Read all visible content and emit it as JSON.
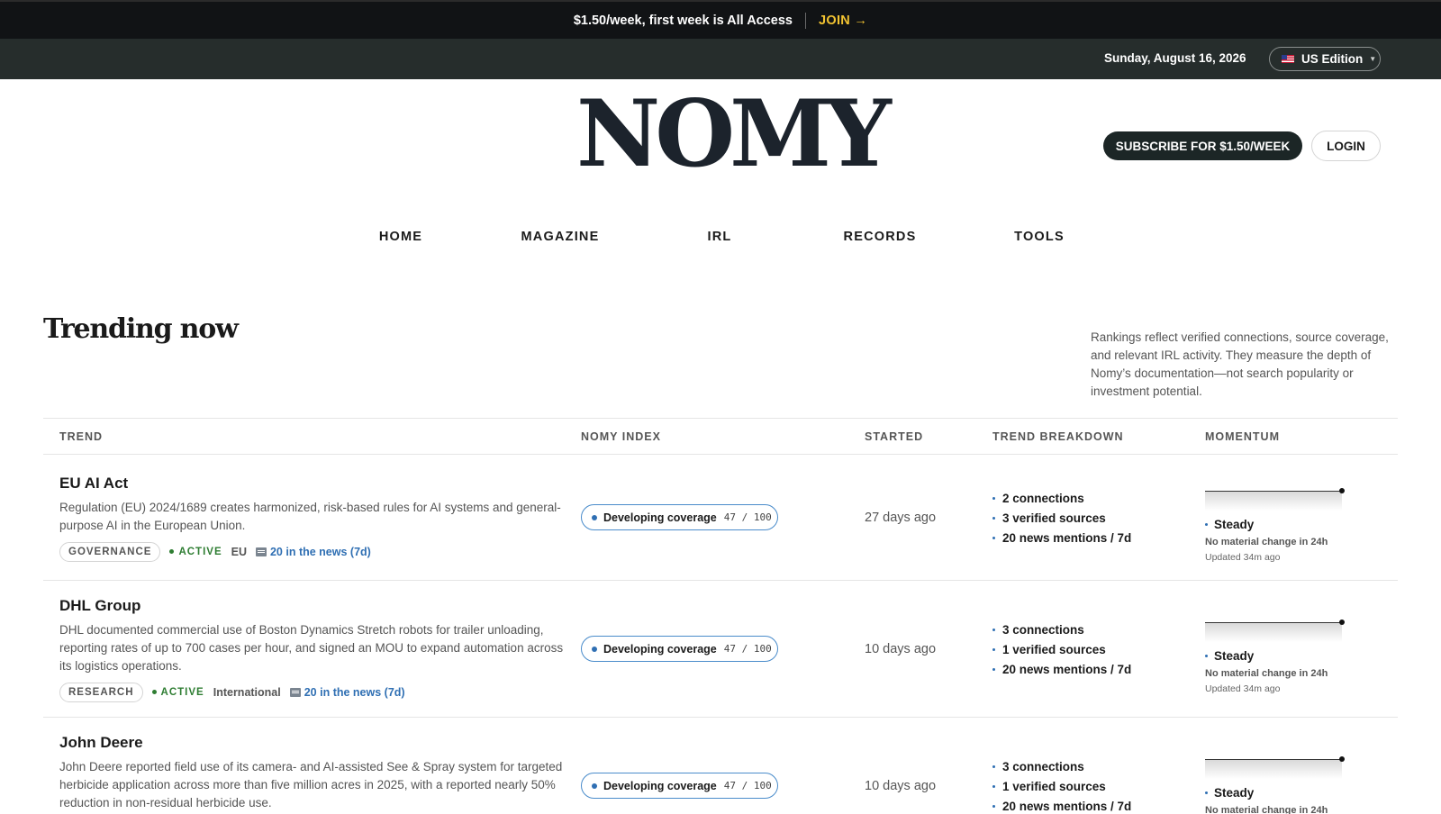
{
  "promo": {
    "text": "$1.50/week, first week is All Access",
    "join_label": "JOIN →"
  },
  "edition_bar": {
    "date": "Sunday, August 16, 2026",
    "edition_label": "US Edition"
  },
  "masthead": {
    "logo": "NOMY",
    "subscribe_label": "SUBSCRIBE FOR $1.50/WEEK",
    "login_label": "LOGIN"
  },
  "nav": {
    "items": [
      "HOME",
      "MAGAZINE",
      "IRL",
      "RECORDS",
      "TOOLS"
    ]
  },
  "section": {
    "title": "Trending now",
    "note": "Rankings reflect verified connections, source coverage, and relevant IRL activity. They measure the depth of Nomy’s documentation—not search popularity or investment potential."
  },
  "table": {
    "headers": [
      "TREND",
      "NOMY INDEX",
      "STARTED",
      "TREND BREAKDOWN",
      "MOMENTUM"
    ],
    "rows": [
      {
        "name": "EU AI Act",
        "description": "Regulation (EU) 2024/1689 creates harmonized, risk-based rules for AI systems and general-purpose AI in the European Union.",
        "tag": "GOVERNANCE",
        "status": "ACTIVE",
        "region": "EU",
        "news": "20 in the news (7d)",
        "index_label": "Developing coverage",
        "index_score": "47 / 100",
        "index_value": 47,
        "started": "27 days ago",
        "breakdown": [
          "2 connections",
          "3 verified sources",
          "20 news mentions / 7d"
        ],
        "momentum_label": "Steady",
        "momentum_note": "No material change in 24h",
        "updated": "Updated 34m ago"
      },
      {
        "name": "DHL Group",
        "description": "DHL documented commercial use of Boston Dynamics Stretch robots for trailer unloading, reporting rates of up to 700 cases per hour, and signed an MOU to expand automation across its logistics operations.",
        "tag": "RESEARCH",
        "status": "ACTIVE",
        "region": "International",
        "news": "20 in the news (7d)",
        "index_label": "Developing coverage",
        "index_score": "47 / 100",
        "index_value": 47,
        "started": "10 days ago",
        "breakdown": [
          "3 connections",
          "1 verified sources",
          "20 news mentions / 7d"
        ],
        "momentum_label": "Steady",
        "momentum_note": "No material change in 24h",
        "updated": "Updated 34m ago"
      },
      {
        "name": "John Deere",
        "description": "John Deere reported field use of its camera- and AI-assisted See & Spray system for targeted herbicide application across more than five million acres in 2025, with a reported nearly 50% reduction in non-residual herbicide use.",
        "index_label": "Developing coverage",
        "index_score": "47 / 100",
        "index_value": 47,
        "started": "10 days ago",
        "breakdown": [
          "3 connections",
          "1 verified sources",
          "20 news mentions / 7d"
        ],
        "momentum_label": "Steady",
        "momentum_note": "No material change in 24h"
      }
    ]
  },
  "colors": {
    "accent_blue": "#2f6fb3",
    "active_green": "#2e7d32",
    "promo_yellow": "#f3c431",
    "dark_bar": "#262d2c"
  }
}
